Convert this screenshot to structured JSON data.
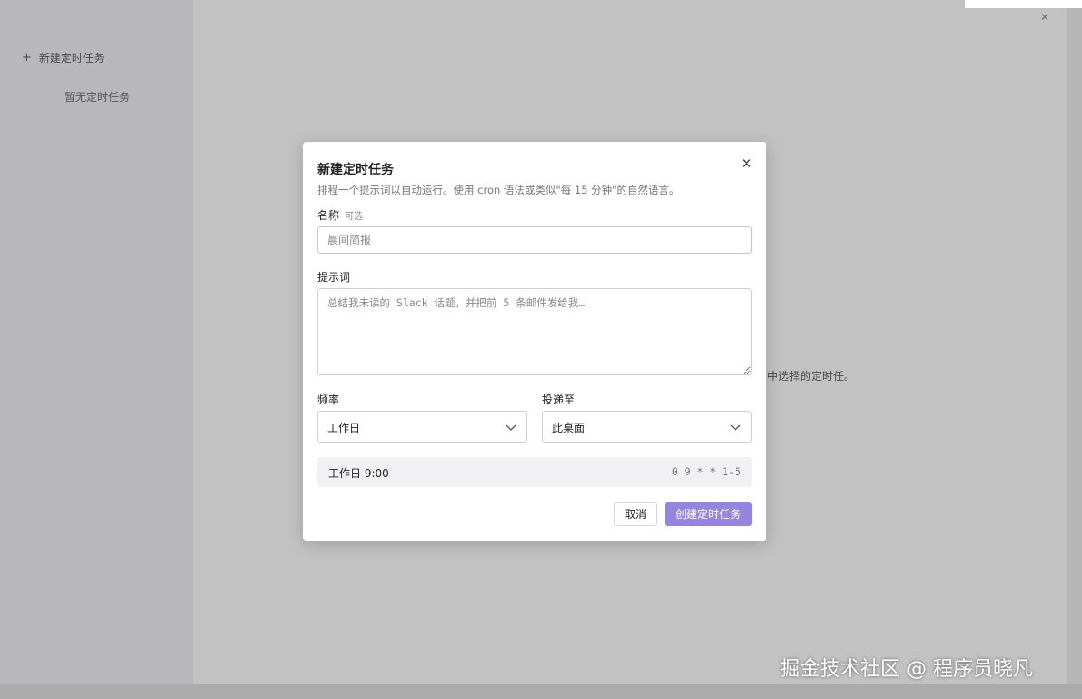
{
  "background": {
    "sidebar": {
      "new_task_icon": "plus-icon",
      "new_task_label": "新建定时任务",
      "empty_text": "暂无定时任务"
    },
    "main_hint": "中选择的定时任。",
    "close_icon": "close-icon",
    "statusbar": [
      "",
      "",
      "",
      ""
    ]
  },
  "dialog": {
    "title": "新建定时任务",
    "description": "排程一个提示词以自动运行。使用 cron 语法或类似\"每 15 分钟\"的自然语言。",
    "close_icon": "close-icon",
    "name": {
      "label": "名称",
      "optional": "可选",
      "value": "",
      "placeholder": "晨间简报"
    },
    "prompt": {
      "label": "提示词",
      "value": "",
      "placeholder": "总结我未读的 Slack 话题，并把前 5 条邮件发给我…"
    },
    "frequency": {
      "label": "频率",
      "selected": "工作日",
      "icon": "chevron-down-icon"
    },
    "deliver_to": {
      "label": "投递至",
      "selected": "此桌面",
      "icon": "chevron-down-icon"
    },
    "summary": {
      "text": "工作日 9:00",
      "cron": "0 9 * * 1-5"
    },
    "buttons": {
      "cancel": "取消",
      "create": "创建定时任务"
    }
  },
  "colors": {
    "accent": "#9585df",
    "overlay": "rgba(40,40,40,0.27)"
  },
  "watermark": "掘金技术社区 @ 程序员晓凡"
}
